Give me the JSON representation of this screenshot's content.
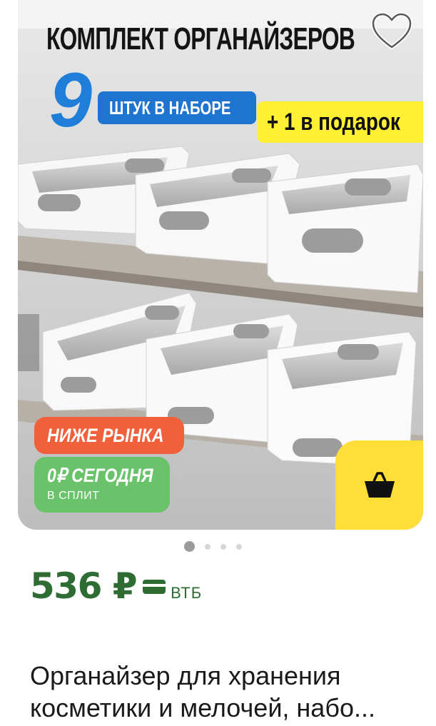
{
  "product": {
    "banner_title": "КОМПЛЕКТ ОРГАНАЙЗЕРОВ",
    "count": "9",
    "count_label": "ШТУК В НАБОРЕ",
    "gift_label": "+ 1 в подарок",
    "badge_market": "НИЖЕ РЫНКА",
    "badge_split_main": "0₽ СЕГОДНЯ",
    "badge_split_sub": "В СПЛИТ",
    "price": "536 ₽",
    "bank": "ВТБ",
    "title": "Органайзер для хранения косметики и мелочей, набо..."
  },
  "gallery": {
    "total": 4,
    "active_index": 0
  },
  "icons": [
    "heart-icon",
    "basket-icon",
    "bank-card-icon"
  ],
  "colors": {
    "price_green": "#2f6c34",
    "cart_yellow": "#ffde38",
    "badge_orange": "#f0603a",
    "badge_green": "#6ac36b",
    "pill_blue": "#1f74d0",
    "gift_yellow": "#fff033"
  }
}
